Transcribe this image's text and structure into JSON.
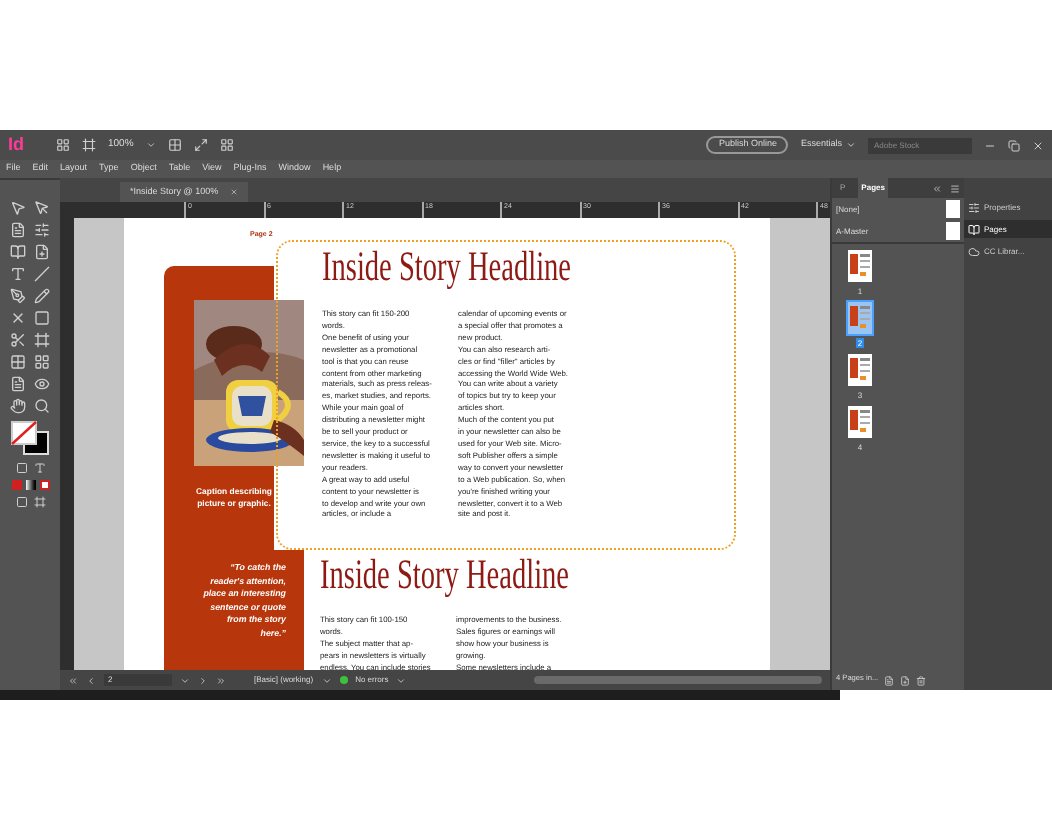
{
  "app_bar": {
    "logo": "Id",
    "zoom": "100%",
    "publish_button": "Publish Online",
    "workspace": "Essentials",
    "search": {
      "placeholder": "Adobe Stock"
    }
  },
  "menu": [
    "File",
    "Edit",
    "Layout",
    "Type",
    "Object",
    "Table",
    "View",
    "Plug-Ins",
    "Window",
    "Help"
  ],
  "document_tab": {
    "title": "*Inside Story @ 100%"
  },
  "ruler_ticks": [
    "0",
    "6",
    "12",
    "18",
    "24",
    "30",
    "36",
    "42",
    "48"
  ],
  "page": {
    "page_label": "Page 2",
    "caption": "Caption describing\npicture or graphic.",
    "quote": "“To catch the\nreader's attention,\nplace an interesting\nsentence or quote\nfrom the story\nhere.”",
    "stories": [
      {
        "headline": "Inside Story Headline",
        "selected": true,
        "columns": [
          "This story can fit 150-200\nwords.\nOne benefit of using your\nnewsletter as a promotional\ntool is that you can reuse\ncontent from other marketing\nmaterials, such as press releas-\nes, market studies, and reports.\nWhile your main goal of\ndistributing a newsletter might\nbe to sell your product or\nservice, the key to a successful\nnewsletter is making it useful to\nyour readers.\nA great way to add useful\ncontent to your newsletter is\nto develop and write your own\narticles, or include a",
          "calendar of upcoming events or\na special offer that promotes a\nnew product.\nYou can also research arti-\ncles or find \"filler\" articles by\naccessing the World Wide Web.\nYou can write about a variety\nof topics but try to keep your\narticles short.\nMuch of the content you put\nin your newsletter can also be\nused for your Web site. Micro-\nsoft Publisher offers a simple\nway to convert your newsletter\nto a Web publication. So, when\nyou're finished writing your\nnewsletter, convert it to a Web\nsite and post it."
        ]
      },
      {
        "headline": "Inside Story Headline",
        "selected": false,
        "columns": [
          "This story can fit 100-150\nwords.\nThe subject matter that ap-\npears in newsletters is virtually\nendless. You can include stories",
          "improvements to the business.\nSales figures or earnings will\nshow how your business is\ngrowing.\nSome newsletters include a"
        ]
      }
    ]
  },
  "status_bar": {
    "page_number": "2",
    "style": "[Basic] (working)",
    "preflight": "No errors"
  },
  "pages_panel": {
    "tabs": [
      {
        "label": "P",
        "selected": false
      },
      {
        "label": "Pages",
        "selected": true
      }
    ],
    "masters": [
      "[None]",
      "A-Master"
    ],
    "pages": [
      {
        "number": "1",
        "selected": false
      },
      {
        "number": "2",
        "selected": true
      },
      {
        "number": "3",
        "selected": false
      },
      {
        "number": "4",
        "selected": false
      }
    ],
    "footer": "4 Pages in..."
  },
  "side_panel": [
    {
      "label": "Properties",
      "selected": false
    },
    {
      "label": "Pages",
      "selected": true
    },
    {
      "label": "CC Librar...",
      "selected": false
    }
  ]
}
